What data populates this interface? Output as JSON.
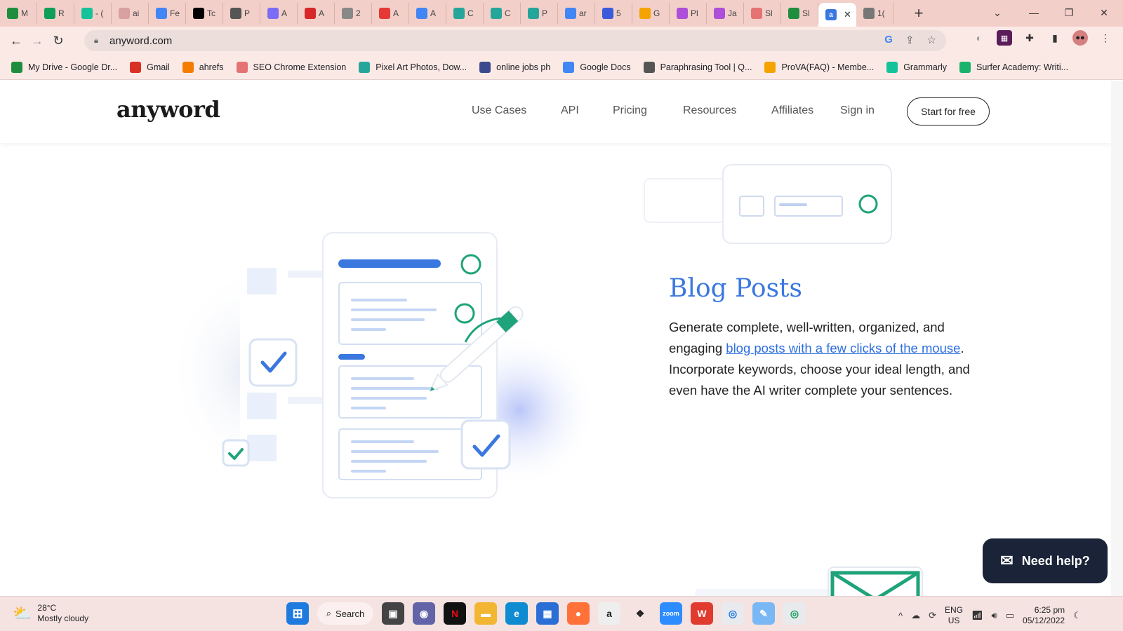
{
  "browser": {
    "tabs": [
      {
        "icon": "google-drive-icon",
        "label": "M",
        "color": "#1e8e3e"
      },
      {
        "icon": "google-sheets-icon",
        "label": "R",
        "color": "#0f9d58"
      },
      {
        "icon": "grammarly-icon",
        "label": "- (",
        "color": "#15c39a"
      },
      {
        "icon": "tab-icon",
        "label": "ai",
        "color": "#d8a0a0"
      },
      {
        "icon": "google-icon",
        "label": "Fe",
        "color": "#4285f4"
      },
      {
        "icon": "medium-icon",
        "label": "Tc",
        "color": "#000000"
      },
      {
        "icon": "quill-icon",
        "label": "P",
        "color": "#555555"
      },
      {
        "icon": "k-icon",
        "label": "A",
        "color": "#7b6cf6"
      },
      {
        "icon": "zyro-icon",
        "label": "A",
        "color": "#d62828"
      },
      {
        "icon": "tab-icon",
        "label": "2",
        "color": "#888888"
      },
      {
        "icon": "ai-writer-icon",
        "label": "A",
        "color": "#e53935"
      },
      {
        "icon": "google-docs-icon",
        "label": "A",
        "color": "#4285f4"
      },
      {
        "icon": "copy-icon",
        "label": "C",
        "color": "#26a69a"
      },
      {
        "icon": "copy-icon",
        "label": "C",
        "color": "#26a69a"
      },
      {
        "icon": "copy-icon",
        "label": "P",
        "color": "#26a69a"
      },
      {
        "icon": "google-icon",
        "label": "ar",
        "color": "#4285f4"
      },
      {
        "icon": "chart-icon",
        "label": "5",
        "color": "#3b5bdb"
      },
      {
        "icon": "ttw-icon",
        "label": "G",
        "color": "#f4a300"
      },
      {
        "icon": "tab-icon",
        "label": "Pl",
        "color": "#ad4fd8"
      },
      {
        "icon": "tab-icon",
        "label": "Ja",
        "color": "#ad4fd8"
      },
      {
        "icon": "tab-icon",
        "label": "Sl",
        "color": "#e57373"
      },
      {
        "icon": "google-drive-icon",
        "label": "Sl",
        "color": "#1e8e3e"
      },
      {
        "icon": "anyword-icon",
        "label": "",
        "color": "#3a78e0",
        "active": true
      },
      {
        "icon": "globe-icon",
        "label": "1(",
        "color": "#777777"
      }
    ],
    "url": "anyword.com",
    "bookmarks": [
      {
        "icon": "google-drive-icon",
        "label": "My Drive - Google Dr...",
        "color": "#1e8e3e"
      },
      {
        "icon": "gmail-icon",
        "label": "Gmail",
        "color": "#d93025"
      },
      {
        "icon": "ahrefs-icon",
        "label": "ahrefs",
        "color": "#f57c00"
      },
      {
        "icon": "seo-extension-icon",
        "label": "SEO Chrome Extension",
        "color": "#e57373"
      },
      {
        "icon": "pixel-art-icon",
        "label": "Pixel Art Photos, Dow...",
        "color": "#26a69a"
      },
      {
        "icon": "globe-icon",
        "label": "online jobs ph",
        "color": "#3b4a8c"
      },
      {
        "icon": "google-docs-icon",
        "label": "Google Docs",
        "color": "#4285f4"
      },
      {
        "icon": "quill-icon",
        "label": "Paraphrasing Tool | Q...",
        "color": "#555555"
      },
      {
        "icon": "prova-icon",
        "label": "ProVA(FAQ) - Membe...",
        "color": "#f4a300"
      },
      {
        "icon": "grammarly-icon",
        "label": "Grammarly",
        "color": "#15c39a"
      },
      {
        "icon": "surfer-icon",
        "label": "Surfer Academy: Writi...",
        "color": "#19b36b"
      }
    ]
  },
  "site": {
    "logo": "anyword",
    "nav": [
      "Use Cases",
      "API",
      "Pricing",
      "Resources",
      "Affiliates",
      "Sign in"
    ],
    "cta": "Start for free",
    "section": {
      "title": "Blog Posts",
      "body_before": "Generate complete, well-written, organized, and engaging ",
      "link": "blog posts with a few clicks of the mouse",
      "body_after": ". Incorporate keywords, choose your ideal length, and even have the AI writer complete your sentences."
    },
    "help_button": "Need help?"
  },
  "taskbar": {
    "weather_temp": "28°C",
    "weather_desc": "Mostly cloudy",
    "search_label": "Search",
    "lang_line1": "ENG",
    "lang_line2": "US",
    "time": "6:25 pm",
    "date": "05/12/2022"
  },
  "colors": {
    "accent": "#3a78e0",
    "help_bg": "#1b2338",
    "illustration_green": "#1fa37a"
  }
}
